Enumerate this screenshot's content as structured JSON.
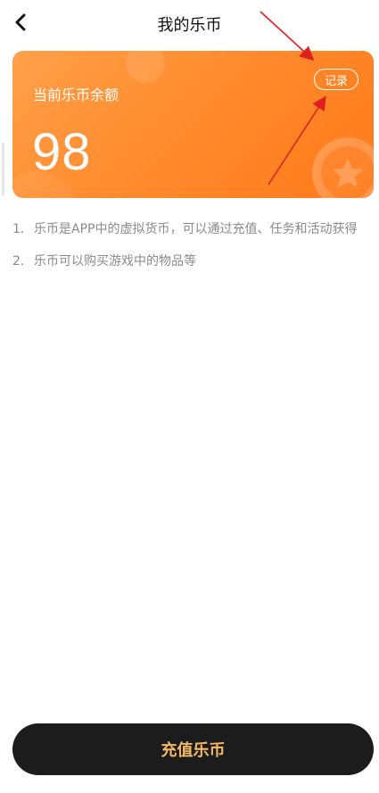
{
  "header": {
    "title": "我的乐币",
    "back_icon": "chevron-left-icon"
  },
  "card": {
    "label": "当前乐币余额",
    "balance": "98",
    "record_label": "记录",
    "colors": {
      "gradient_start": "#ffa04a",
      "gradient_end": "#ff7a1a"
    }
  },
  "notes": [
    {
      "num": "1.",
      "text": "乐币是APP中的虚拟货币，可以通过充值、任务和活动获得"
    },
    {
      "num": "2.",
      "text": "乐币可以购买游戏中的物品等"
    }
  ],
  "footer": {
    "recharge_label": "充值乐币",
    "colors": {
      "button_bg": "#1c1c1c",
      "label": "#f5b867"
    }
  },
  "annotation": {
    "arrow_color": "#e02020"
  }
}
